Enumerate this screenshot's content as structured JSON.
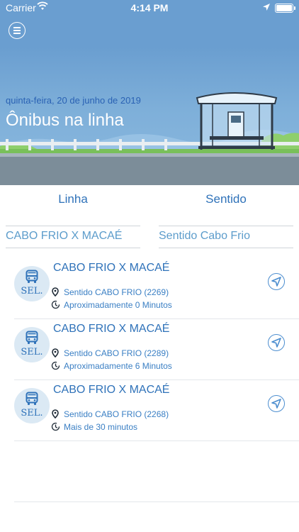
{
  "status_bar": {
    "carrier": "Carrier",
    "time": "4:14 PM"
  },
  "header": {
    "date": "quinta-feira, 20 de junho de 2019",
    "title": "Ônibus na linha"
  },
  "tabs": {
    "linha": "Linha",
    "sentido": "Sentido"
  },
  "filters": {
    "linha_value": "CABO FRIO X MACAÉ",
    "sentido_value": "Sentido Cabo Frio"
  },
  "colors": {
    "accent": "#2f72b9",
    "navbar": "#6a9ed0",
    "text_light": "#5c9ccb"
  },
  "buses": [
    {
      "badge": "SEL.",
      "route": "CABO FRIO X MACAÉ",
      "direction": "Sentido CABO FRIO (2269)",
      "eta": "Aproximadamente 0 Minutos"
    },
    {
      "badge": "SEL.",
      "route": "CABO FRIO X MACAÉ",
      "direction": "Sentido CABO FRIO (2289)",
      "eta": "Aproximadamente 6 Minutos"
    },
    {
      "badge": "SEL.",
      "route": "CABO FRIO X MACAÉ",
      "direction": "Sentido CABO FRIO (2268)",
      "eta": "Mais de 30 minutos"
    }
  ]
}
